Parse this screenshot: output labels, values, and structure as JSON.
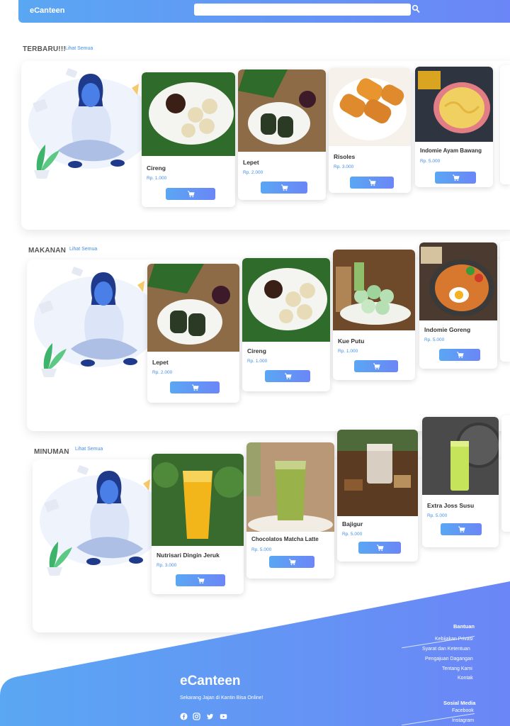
{
  "navbar": {
    "brand": "eCanteen"
  },
  "sections": [
    {
      "title": "TERBARU!!!",
      "see_all": "Lihat Semua",
      "items": [
        {
          "name": "Cireng",
          "price": "Rp. 1.000"
        },
        {
          "name": "Lepet",
          "price": "Rp. 2.000"
        },
        {
          "name": "Risoles",
          "price": "Rp. 3.000"
        },
        {
          "name": "Indomie Ayam Bawang",
          "price": "Rp. 5.000"
        }
      ]
    },
    {
      "title": "MAKANAN",
      "see_all": "Lihat Semua",
      "items": [
        {
          "name": "Lepet",
          "price": "Rp. 2.000"
        },
        {
          "name": "Cireng",
          "price": "Rp. 1.000"
        },
        {
          "name": "Kue Putu",
          "price": "Rp. 1.000"
        },
        {
          "name": "Indomie Goreng",
          "price": "Rp. 5.000"
        }
      ]
    },
    {
      "title": "MINUMAN",
      "see_all": "Lihat Semua",
      "items": [
        {
          "name": "Nutrisari Dingin Jeruk",
          "price": "Rp. 3.000"
        },
        {
          "name": "Chocolatos Matcha Latte",
          "price": "Rp. 5.000"
        },
        {
          "name": "Bajigur",
          "price": "Rp. 5.000"
        },
        {
          "name": "Extra Joss Susu",
          "price": "Rp. 5.000"
        }
      ]
    }
  ],
  "footer": {
    "brand": "eCanteen",
    "tagline": "Sekarang Jajan di Kantin Bisa Online!",
    "help_title": "Bantuan",
    "help_links": [
      "Kebijakan Privasi",
      "Syarat dan Ketentuan",
      "Pengajuan Dagangan",
      "Tentang Kami",
      "Kontak"
    ],
    "social_title": "Sosial Media",
    "social_links": [
      "Facebook",
      "Instagram"
    ]
  },
  "colors": {
    "accent": "#3f8ef0",
    "gradient_start": "#5aa7f3",
    "gradient_end": "#6b86f6"
  }
}
